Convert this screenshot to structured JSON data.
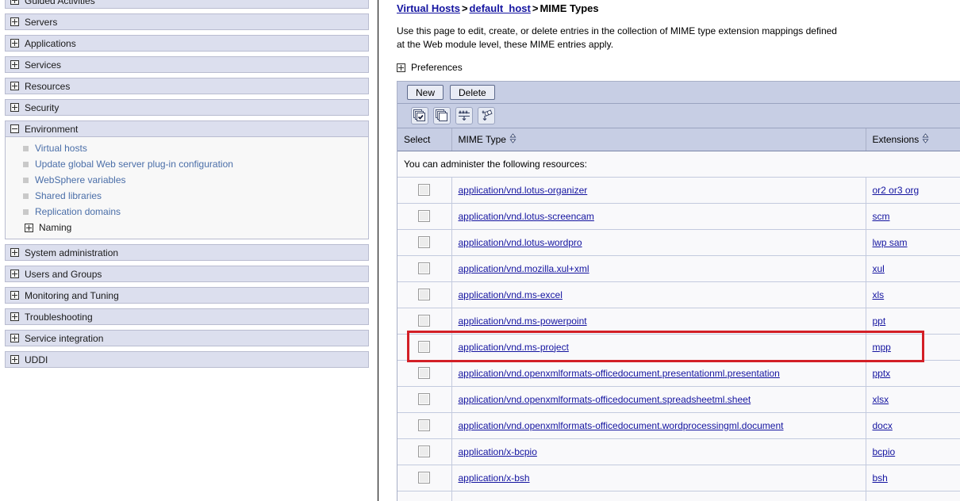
{
  "sidebar": {
    "groups": [
      {
        "label": "Guided Activities",
        "state": "collapsed",
        "icon": "plus-icon"
      },
      {
        "label": "Servers",
        "state": "collapsed",
        "icon": "plus-icon"
      },
      {
        "label": "Applications",
        "state": "collapsed",
        "icon": "plus-icon"
      },
      {
        "label": "Services",
        "state": "collapsed",
        "icon": "plus-icon"
      },
      {
        "label": "Resources",
        "state": "collapsed",
        "icon": "plus-icon"
      },
      {
        "label": "Security",
        "state": "collapsed",
        "icon": "plus-icon"
      },
      {
        "label": "Environment",
        "state": "expanded",
        "icon": "minus-icon"
      },
      {
        "label": "System administration",
        "state": "collapsed",
        "icon": "plus-icon"
      },
      {
        "label": "Users and Groups",
        "state": "collapsed",
        "icon": "plus-icon"
      },
      {
        "label": "Monitoring and Tuning",
        "state": "collapsed",
        "icon": "plus-icon"
      },
      {
        "label": "Troubleshooting",
        "state": "collapsed",
        "icon": "plus-icon"
      },
      {
        "label": "Service integration",
        "state": "collapsed",
        "icon": "plus-icon"
      },
      {
        "label": "UDDI",
        "state": "collapsed",
        "icon": "plus-icon"
      }
    ],
    "environment_children": [
      "Virtual hosts",
      "Update global Web server plug-in configuration",
      "WebSphere variables",
      "Shared libraries",
      "Replication domains"
    ],
    "environment_subgroup": {
      "label": "Naming",
      "icon": "plus-icon"
    }
  },
  "main": {
    "breadcrumb": {
      "link1": "Virtual Hosts",
      "sep1": ">",
      "link2": "default_host",
      "sep2": ">",
      "current": "MIME Types"
    },
    "description_line1": "Use this page to edit, create, or delete entries in the collection of MIME type extension mappings defined",
    "description_line2": "at the Web module level, these MIME entries apply.",
    "preferences_label": "Preferences",
    "buttons": {
      "new": "New",
      "delete": "Delete"
    },
    "tool_icons": [
      {
        "name": "select-all-icon",
        "title": "Select all items"
      },
      {
        "name": "deselect-all-icon",
        "title": "Deselect all items"
      },
      {
        "name": "show-filter-icon",
        "title": "Show filter row"
      },
      {
        "name": "clear-filter-icon",
        "title": "Clear filter row"
      }
    ],
    "table": {
      "headers": {
        "select": "Select",
        "mime_type": "MIME Type",
        "extensions": "Extensions"
      },
      "admin_note": "You can administer the following resources:",
      "rows": [
        {
          "mime_type": "application/vnd.lotus-organizer",
          "extensions": "or2 or3 org",
          "highlighted": false
        },
        {
          "mime_type": "application/vnd.lotus-screencam",
          "extensions": "scm",
          "highlighted": false
        },
        {
          "mime_type": "application/vnd.lotus-wordpro",
          "extensions": "lwp sam",
          "highlighted": false
        },
        {
          "mime_type": "application/vnd.mozilla.xul+xml",
          "extensions": "xul",
          "highlighted": false
        },
        {
          "mime_type": "application/vnd.ms-excel",
          "extensions": "xls",
          "highlighted": false
        },
        {
          "mime_type": "application/vnd.ms-powerpoint",
          "extensions": "ppt",
          "highlighted": false
        },
        {
          "mime_type": "application/vnd.ms-project",
          "extensions": "mpp",
          "highlighted": true
        },
        {
          "mime_type": "application/vnd.openxmlformats-officedocument.presentationml.presentation",
          "extensions": "pptx",
          "highlighted": false
        },
        {
          "mime_type": "application/vnd.openxmlformats-officedocument.spreadsheetml.sheet",
          "extensions": "xlsx",
          "highlighted": false
        },
        {
          "mime_type": "application/vnd.openxmlformats-officedocument.wordprocessingml.document",
          "extensions": "docx",
          "highlighted": false
        },
        {
          "mime_type": "application/x-bcpio",
          "extensions": "bcpio",
          "highlighted": false
        },
        {
          "mime_type": "application/x-bsh",
          "extensions": "bsh",
          "highlighted": false
        }
      ]
    }
  },
  "annotation": {
    "color": "#d31f26",
    "target_row": "application/vnd.ms-project"
  }
}
